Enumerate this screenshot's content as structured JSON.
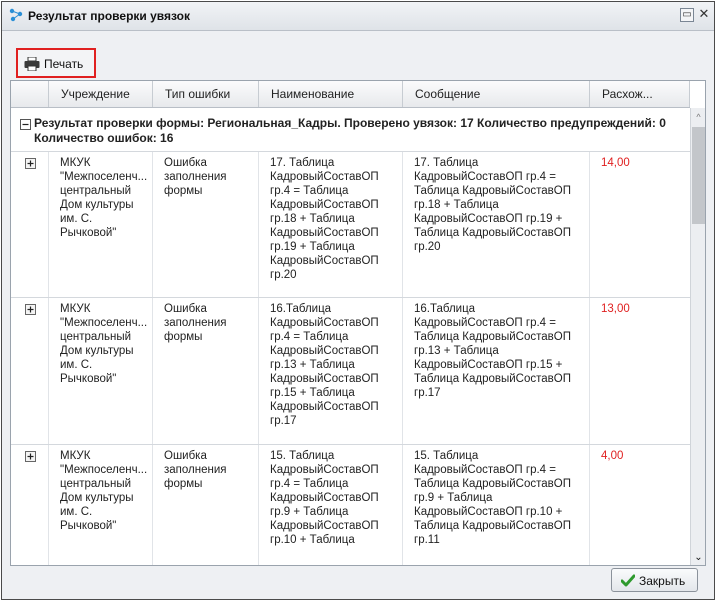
{
  "window": {
    "title": "Результат проверки увязок",
    "icons": {
      "title": "link-check-icon",
      "maximize": "restore-icon",
      "close": "close-icon"
    }
  },
  "toolbar": {
    "print_label": "Печать",
    "print_icon": "printer-icon"
  },
  "grid": {
    "columns": [
      "Учреждение",
      "Тип ошибки",
      "Наименование",
      "Сообщение",
      "Расхож..."
    ],
    "group_text": "Результат проверки формы: Региональная_Кадры. Проверено увязок: 17 Количество предупреждений: 0 Количество ошибок: 16",
    "rows": [
      {
        "org": "МКУК\n\"Межпоселенч...\nцентральный\nДом культуры\nим. С.\nРычковой\"",
        "error_type": "Ошибка\nзаполнения\nформы",
        "name": "17. Таблица\nКадровыйСоставОП\nгр.4 = Таблица\nКадровыйСоставОП\nгр.18 + Таблица\nКадровыйСоставОП\nгр.19 + Таблица\nКадровыйСоставОП\nгр.20",
        "message": "17. Таблица\nКадровыйСоставОП гр.4 =\nТаблица КадровыйСоставОП\nгр.18 + Таблица\nКадровыйСоставОП гр.19 +\nТаблица КадровыйСоставОП\nгр.20",
        "diff": "14,00"
      },
      {
        "org": "МКУК\n\"Межпоселенч...\nцентральный\nДом культуры\nим. С.\nРычковой\"",
        "error_type": "Ошибка\nзаполнения\nформы",
        "name": "16.Таблица\nКадровыйСоставОП\nгр.4 = Таблица\nКадровыйСоставОП\nгр.13 + Таблица\nКадровыйСоставОП\nгр.15 + Таблица\nКадровыйСоставОП\nгр.17",
        "message": "16.Таблица\nКадровыйСоставОП гр.4 =\nТаблица КадровыйСоставОП\nгр.13 + Таблица\nКадровыйСоставОП гр.15 +\nТаблица КадровыйСоставОП\nгр.17",
        "diff": "13,00"
      },
      {
        "org": "МКУК\n\"Межпоселенч...\nцентральный\nДом культуры\nим. С.\nРычковой\"",
        "error_type": "Ошибка\nзаполнения\nформы",
        "name": "15. Таблица\nКадровыйСоставОП\nгр.4 = Таблица\nКадровыйСоставОП\nгр.9 + Таблица\nКадровыйСоставОП\nгр.10 + Таблица",
        "message": "15. Таблица\nКадровыйСоставОП гр.4 =\nТаблица КадровыйСоставОП\nгр.9 + Таблица\nКадровыйСоставОП гр.10 +\nТаблица КадровыйСоставОП\nгр.11",
        "diff": "4,00"
      }
    ]
  },
  "footer": {
    "close_label": "Закрыть",
    "close_icon": "checkmark-icon"
  },
  "colors": {
    "accent_red": "#e02020",
    "check_green": "#2e9a2e"
  }
}
